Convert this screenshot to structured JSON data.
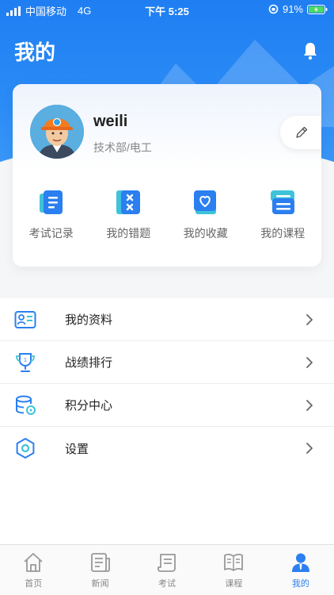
{
  "status_bar": {
    "carrier": "中国移动",
    "network": "4G",
    "time": "下午 5:25",
    "battery": "91%"
  },
  "header": {
    "title": "我的",
    "notification_icon": "bell-icon"
  },
  "profile": {
    "username": "weili",
    "department": "技术部/电工",
    "edit_icon": "pencil-icon"
  },
  "shortcuts": [
    {
      "label": "考试记录",
      "icon": "exam-record-icon"
    },
    {
      "label": "我的错题",
      "icon": "wrong-questions-icon"
    },
    {
      "label": "我的收藏",
      "icon": "favorites-icon"
    },
    {
      "label": "我的课程",
      "icon": "courses-icon"
    }
  ],
  "menu": [
    {
      "label": "我的资料",
      "icon": "profile-card-icon"
    },
    {
      "label": "战绩排行",
      "icon": "trophy-icon"
    },
    {
      "label": "积分中心",
      "icon": "coins-icon"
    },
    {
      "label": "设置",
      "icon": "settings-icon"
    }
  ],
  "tabbar": [
    {
      "label": "首页",
      "icon": "home-icon",
      "active": false
    },
    {
      "label": "新闻",
      "icon": "news-icon",
      "active": false
    },
    {
      "label": "考试",
      "icon": "exam-icon",
      "active": false
    },
    {
      "label": "课程",
      "icon": "book-icon",
      "active": false
    },
    {
      "label": "我的",
      "icon": "user-icon",
      "active": true
    }
  ],
  "colors": {
    "primary": "#2b7ff0",
    "header_blue": "#1f7ef2",
    "accent_teal": "#3ec3d8",
    "inactive": "#888888"
  }
}
